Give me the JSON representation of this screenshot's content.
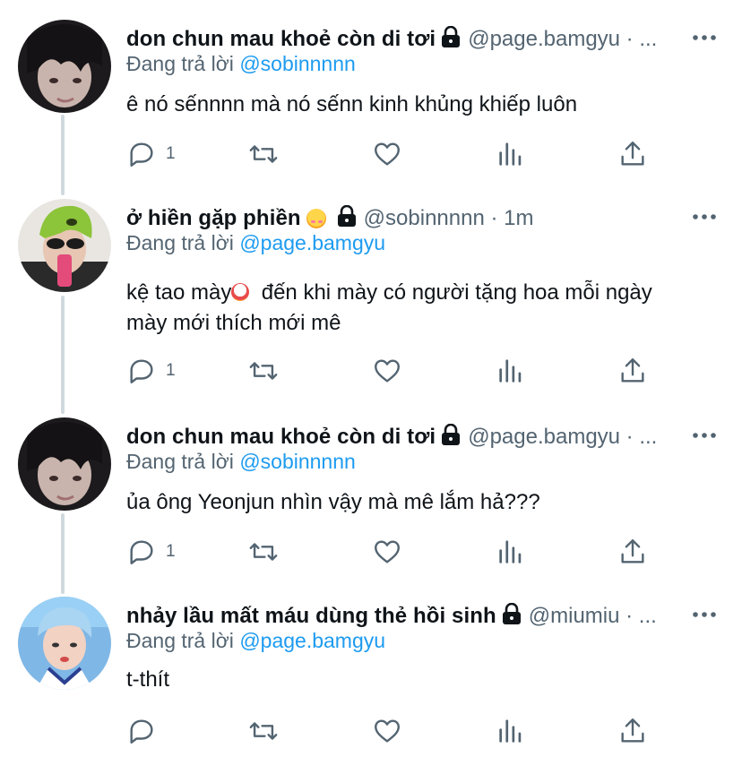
{
  "tweets": [
    {
      "name": "don chun mau khoẻ còn di tơi",
      "handle": "@page.bamgyu · ...",
      "reply_prefix": "Đang trả lời",
      "reply_to": "@sobinnnnn",
      "text": [
        "ê nó sếnnnn mà nó sếnn kinh khủng khiếp luôn"
      ],
      "reply_count": "1",
      "avatar": "avatar-dark-hair"
    },
    {
      "name": "ở hiền gặp phiền",
      "handle": "@sobinnnnn · 1m",
      "reply_prefix": "Đang trả lời",
      "reply_to": "@page.bamgyu",
      "text": [
        "kệ tao mày",
        "  đến khi mày có người tặng hoa mỗi ngày",
        "mày mới thích mới mê"
      ],
      "reply_count": "1",
      "avatar": "avatar-green-hat"
    },
    {
      "name": "don chun mau khoẻ còn di tơi",
      "handle": "@page.bamgyu · ...",
      "reply_prefix": "Đang trả lời",
      "reply_to": "@sobinnnnn",
      "text": [
        "ủa ông Yeonjun nhìn vậy mà mê lắm hả???"
      ],
      "reply_count": "1",
      "avatar": "avatar-dark-hair"
    },
    {
      "name": "nhảy lầu mất máu dùng thẻ hồi sinh",
      "handle": "@miumiu · ...",
      "reply_prefix": "Đang trả lời",
      "reply_to": "@page.bamgyu",
      "text": [
        "t-thít"
      ],
      "reply_count": "",
      "avatar": "avatar-blue-hair"
    }
  ],
  "icons": {
    "reply": "reply-icon",
    "retweet": "retweet-icon",
    "like": "like-icon",
    "views": "views-icon",
    "share": "share-icon",
    "more": "more-icon",
    "lock": "lock-icon"
  },
  "colors": {
    "mention": "#1d9bf0",
    "secondary": "#536471",
    "text": "#0f1419",
    "thread_line": "#cfd9de"
  }
}
